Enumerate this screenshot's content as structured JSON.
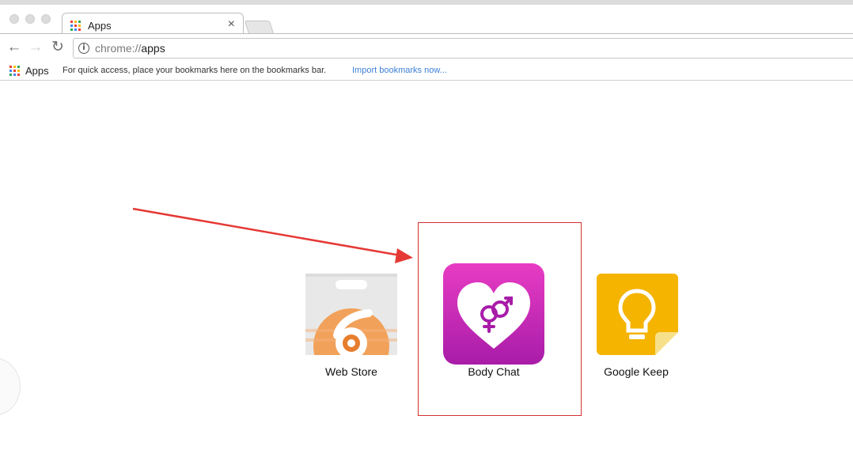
{
  "window": {
    "tab": {
      "title": "Apps",
      "close": "×"
    }
  },
  "toolbar": {
    "back": "←",
    "forward": "→",
    "reload": "↻",
    "info": "i",
    "url_scheme": "chrome://",
    "url_path": "apps"
  },
  "bookmarks_bar": {
    "apps_label": "Apps",
    "hint": "For quick access, place your bookmarks here on the bookmarks bar.",
    "import_link": "Import bookmarks now..."
  },
  "apps": [
    {
      "name": "Web Store",
      "icon": "web-store-icon"
    },
    {
      "name": "Body Chat",
      "icon": "body-chat-icon"
    },
    {
      "name": "Google Keep",
      "icon": "google-keep-icon"
    }
  ],
  "colors": {
    "highlight": "#d32f2f",
    "arrow": "#e53935",
    "link": "#3d7fd6",
    "body_chat": "#c81ec8",
    "keep": "#f4b400"
  }
}
